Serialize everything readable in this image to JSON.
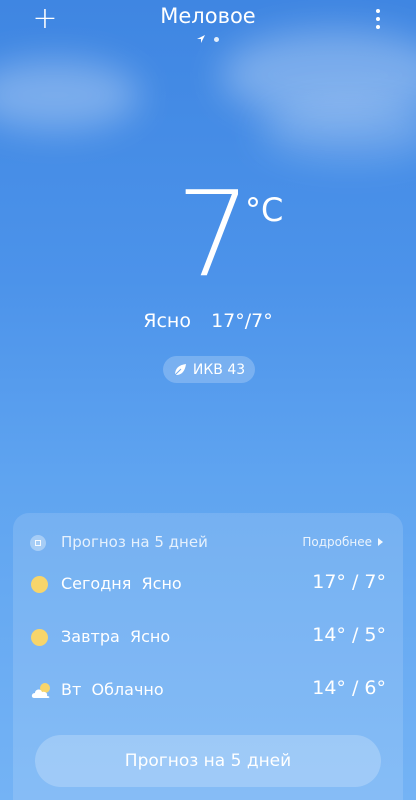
{
  "header": {
    "add_label": "+",
    "city": "Меловое"
  },
  "current": {
    "temperature": "7",
    "unit": "°C",
    "condition": "Ясно",
    "high_low": "17°/7°",
    "aqi_label": "ИКВ 43"
  },
  "forecast": {
    "title": "Прогноз на 5 дней",
    "more_label": "Подробнее",
    "days": [
      {
        "day": "Сегодня",
        "condition": "Ясно",
        "range": "17° / 7°",
        "icon": "sun-icon"
      },
      {
        "day": "Завтра",
        "condition": "Ясно",
        "range": "14° / 5°",
        "icon": "sun-icon"
      },
      {
        "day": "Вт",
        "condition": "Облачно",
        "range": "14° / 6°",
        "icon": "cloudy-icon"
      }
    ],
    "button_label": "Прогноз на 5 дней"
  },
  "colors": {
    "sky_top": "#3f86e2",
    "sky_bottom": "#74b3f5",
    "sun": "#f7d56b"
  }
}
